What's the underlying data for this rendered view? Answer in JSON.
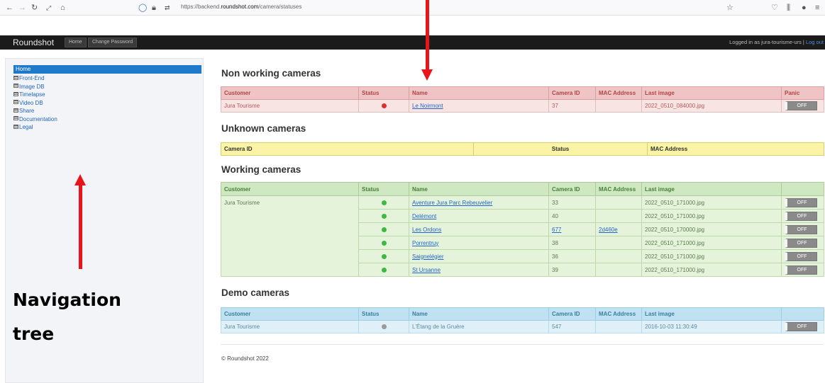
{
  "browser": {
    "url_prefix": "https://backend.",
    "url_domain": "roundshot.com",
    "url_path": "/camera/statuses",
    "icons": [
      "back-icon",
      "forward-icon",
      "reload-icon",
      "expand-icon",
      "home-icon",
      "shield-icon",
      "lock-icon",
      "permissions-icon",
      "star-icon",
      "pocket-icon",
      "library-icon",
      "extension-icon",
      "menu-icon"
    ]
  },
  "header": {
    "brand": "Roundshot",
    "nav": [
      "Home",
      "Change Password"
    ],
    "logged_in_text": "Logged in as jura-tourisme-urs |",
    "logout": "Log out"
  },
  "sidebar": {
    "items": [
      {
        "label": "Home",
        "active": true
      },
      {
        "label": "Front-End",
        "active": false
      },
      {
        "label": "Image DB",
        "active": false
      },
      {
        "label": "Timelapse",
        "active": false
      },
      {
        "label": "Video DB",
        "active": false
      },
      {
        "label": "Share",
        "active": false
      },
      {
        "label": "Documentation",
        "active": false
      },
      {
        "label": "Legal",
        "active": false
      }
    ]
  },
  "sections": {
    "non_working": {
      "title": "Non working cameras",
      "headers": [
        "Customer",
        "Status",
        "Name",
        "Camera ID",
        "MAC Address",
        "Last image",
        "Panic"
      ],
      "rows": [
        {
          "customer": "Jura Tourisme",
          "status": "red",
          "name": "Le Noirmont",
          "camera_id": "37",
          "mac": "",
          "last_image": "2022_0510_084000.jpg",
          "panic": "OFF"
        }
      ]
    },
    "unknown": {
      "title": "Unknown cameras",
      "headers": [
        "Camera ID",
        "Status",
        "MAC Address"
      ]
    },
    "working": {
      "title": "Working cameras",
      "headers": [
        "Customer",
        "Status",
        "Name",
        "Camera ID",
        "MAC Address",
        "Last image",
        ""
      ],
      "customer": "Jura Tourisme",
      "rows": [
        {
          "status": "green",
          "name": "Aventure Jura Parc Rebeuvelier",
          "camera_id": "33",
          "camera_id_link": false,
          "mac": "",
          "last_image": "2022_0510_171000.jpg",
          "panic": "OFF"
        },
        {
          "status": "green",
          "name": "Delémont",
          "camera_id": "40",
          "camera_id_link": false,
          "mac": "",
          "last_image": "2022_0510_171000.jpg",
          "panic": "OFF"
        },
        {
          "status": "green",
          "name": "Les Ordons",
          "camera_id": "677",
          "camera_id_link": true,
          "mac": "2d460e",
          "last_image": "2022_0510_170000.jpg",
          "panic": "OFF"
        },
        {
          "status": "green",
          "name": "Porrentruy",
          "camera_id": "38",
          "camera_id_link": false,
          "mac": "",
          "last_image": "2022_0510_171000.jpg",
          "panic": "OFF"
        },
        {
          "status": "green",
          "name": "Saignelégier",
          "camera_id": "36",
          "camera_id_link": false,
          "mac": "",
          "last_image": "2022_0510_171000.jpg",
          "panic": "OFF"
        },
        {
          "status": "green",
          "name": "St Ursanne",
          "camera_id": "39",
          "camera_id_link": false,
          "mac": "",
          "last_image": "2022_0510_171000.jpg",
          "panic": "OFF"
        }
      ]
    },
    "demo": {
      "title": "Demo cameras",
      "headers": [
        "Customer",
        "Status",
        "Name",
        "Camera ID",
        "MAC Address",
        "Last image",
        ""
      ],
      "rows": [
        {
          "customer": "Jura Tourisme",
          "status": "grey",
          "name": "L'Étang de la Gruère",
          "camera_id": "547",
          "mac": "",
          "last_image": "2016-10-03 11:30:49",
          "panic": "OFF"
        }
      ]
    }
  },
  "footer": "© Roundshot 2022",
  "annotation": {
    "line1": "Navigation",
    "line2": "tree"
  },
  "colors": {
    "arrow": "#e8141a",
    "status_red": "#d93030",
    "status_green": "#3db843",
    "status_grey": "#999999"
  }
}
